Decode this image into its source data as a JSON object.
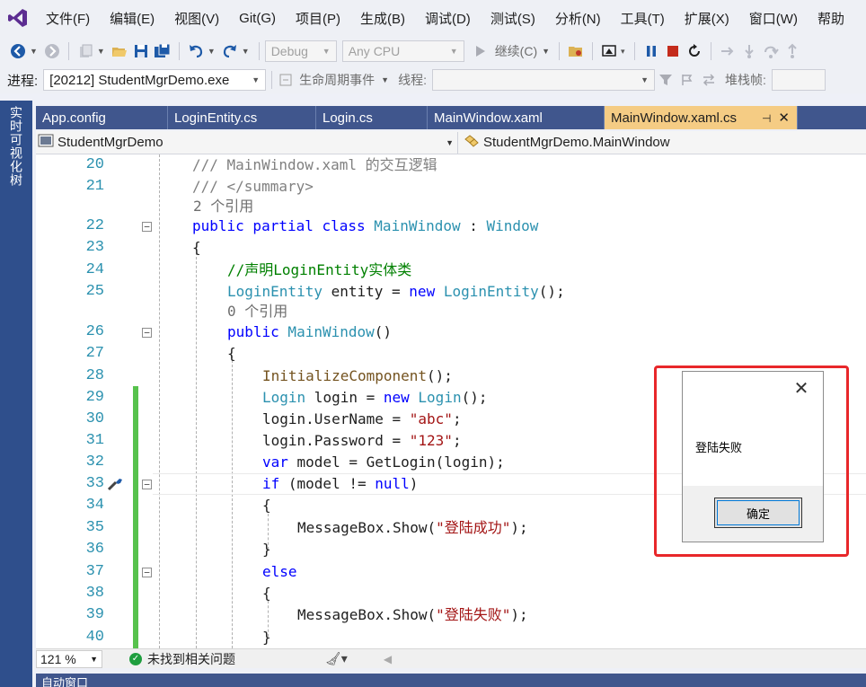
{
  "menu": [
    "文件(F)",
    "编辑(E)",
    "视图(V)",
    "Git(G)",
    "项目(P)",
    "生成(B)",
    "调试(D)",
    "测试(S)",
    "分析(N)",
    "工具(T)",
    "扩展(X)",
    "窗口(W)",
    "帮助"
  ],
  "toolbar": {
    "config": "Debug",
    "platform": "Any CPU",
    "continue": "继续(C)"
  },
  "debugbar": {
    "process_label": "进程:",
    "process_value": "[20212] StudentMgrDemo.exe",
    "lifecycle": "生命周期事件",
    "thread_label": "线程:",
    "stack_label": "堆栈帧:"
  },
  "side_tab": "实时可视化树",
  "tabs": [
    "App.config",
    "LoginEntity.cs",
    "Login.cs",
    "MainWindow.xaml",
    "MainWindow.xaml.cs"
  ],
  "nav": {
    "project": "StudentMgrDemo",
    "class": "StudentMgrDemo.MainWindow"
  },
  "code": {
    "ln20": "20",
    "ln21": "21",
    "ln22": "22",
    "ln23": "23",
    "ln24": "24",
    "ln25": "25",
    "ln26": "26",
    "ln27": "27",
    "ln28": "28",
    "ln29": "29",
    "ln30": "30",
    "ln31": "31",
    "ln32": "32",
    "ln33": "33",
    "ln34": "34",
    "ln35": "35",
    "ln36": "36",
    "ln37": "37",
    "ln38": "38",
    "ln39": "39",
    "ln40": "40",
    "refs2": "2 个引用",
    "refs0": "0 个引用",
    "l20": "/// MainWindow.xaml 的交互逻辑",
    "l21": "/// </summary>",
    "l22_kw": "public partial class",
    "l22_name": "MainWindow",
    "l22_sep": " : ",
    "l22_base": "Window",
    "brace_open": "{",
    "brace_close": "}",
    "l24": "//声明LoginEntity实体类",
    "l25_type": "LoginEntity",
    "l25_var": " entity = ",
    "l25_new": "new",
    "l25_ctor": " LoginEntity",
    "l25_end": "();",
    "l26_kw": "public",
    "l26_name": " MainWindow",
    "l26_end": "()",
    "l28_call": "InitializeComponent",
    "l28_end": "();",
    "l29_type": "Login",
    "l29_var": " login = ",
    "l29_new": "new",
    "l29_ctor": " Login",
    "l29_end": "();",
    "l30_a": "login.UserName = ",
    "l30_s": "\"abc\"",
    "l30_e": ";",
    "l31_a": "login.Password = ",
    "l31_s": "\"123\"",
    "l31_e": ";",
    "l32_kw": "var",
    "l32_a": " model = GetLogin(login);",
    "l33_kw": "if",
    "l33_a": " (model != ",
    "l33_null": "null",
    "l33_e": ")",
    "l35_a": "MessageBox.Show(",
    "l35_s": "\"登陆成功\"",
    "l35_e": ");",
    "l37_kw": "else",
    "l39_a": "MessageBox.Show(",
    "l39_s": "\"登陆失败\"",
    "l39_e": ");"
  },
  "status": {
    "zoom": "121 %",
    "issues": "未找到相关问题"
  },
  "bottom_panel": "自动窗口",
  "dialog": {
    "message": "登陆失败",
    "ok": "确定"
  },
  "colors": {
    "accent_tab": "#f5cc84",
    "highlight": "#e8272a",
    "change_bar": "#57c24d"
  }
}
